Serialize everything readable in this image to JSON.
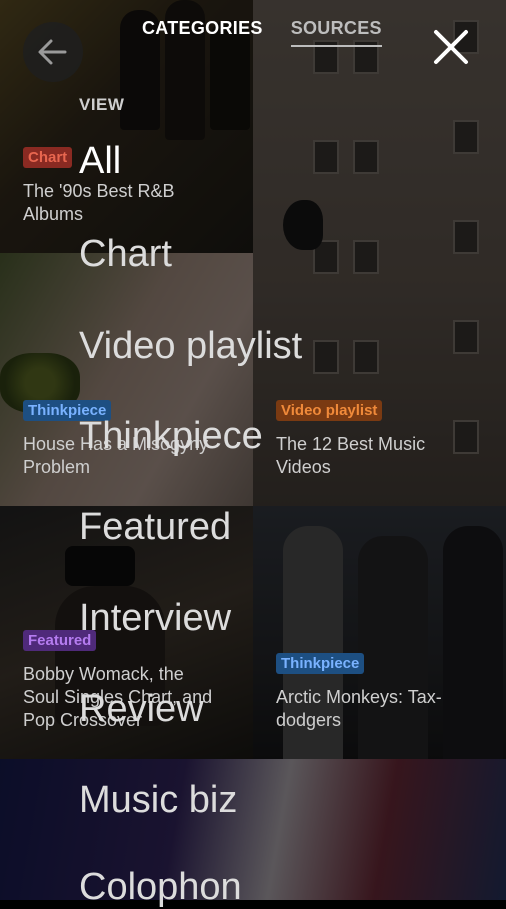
{
  "header": {
    "tabs": [
      {
        "label": "CATEGORIES"
      },
      {
        "label": "SOURCES"
      }
    ]
  },
  "menu": {
    "section_label": "VIEW",
    "items": [
      {
        "label": "All"
      },
      {
        "label": "Chart"
      },
      {
        "label": "Video playlist"
      },
      {
        "label": "Thinkpiece"
      },
      {
        "label": "Featured"
      },
      {
        "label": "Interview"
      },
      {
        "label": "Review"
      },
      {
        "label": "Music biz"
      },
      {
        "label": "Colophon"
      }
    ]
  },
  "cards": [
    {
      "tag": "Chart",
      "title_line1": "The '90s Best R&B",
      "title_line2": "Albums"
    },
    {
      "tag": "Thinkpiece",
      "title_line1": "House Has a Misogyny",
      "title_line2": "Problem"
    },
    {
      "tag": "Video playlist",
      "title_line1": "The 12 Best Music",
      "title_line2": "Videos"
    },
    {
      "tag": "Featured",
      "title_line1": "Bobby Womack, the",
      "title_line2": "Soul Singles Chart, and",
      "title_line3": "Pop Crossover"
    },
    {
      "tag": "Thinkpiece",
      "title_line1": "Arctic Monkeys: Tax-",
      "title_line2": "dodgers"
    }
  ],
  "icons": {
    "back": "arrow-left-icon",
    "close": "close-icon"
  },
  "colors": {
    "chart_tag": "#e8664f",
    "thinkpiece_tag": "#79b2ff",
    "video_tag": "#f08a3a",
    "featured_tag": "#b57cf0"
  }
}
